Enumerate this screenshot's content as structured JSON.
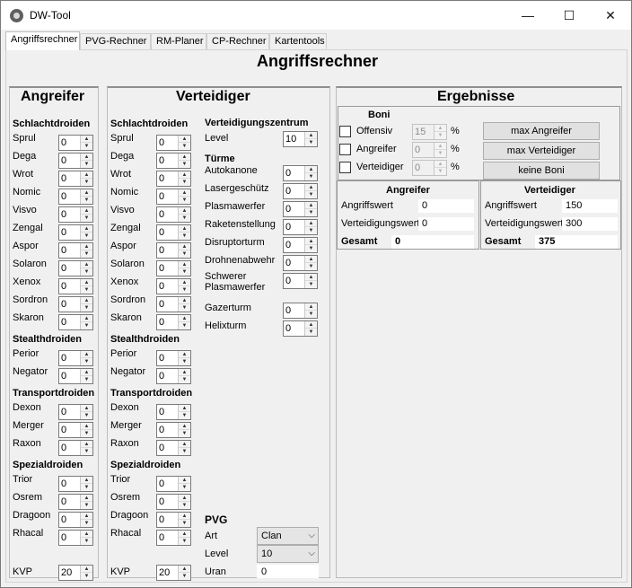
{
  "window": {
    "title": "DW-Tool",
    "minimize": "—",
    "maximize": "☐",
    "close": "✕"
  },
  "tabs": [
    "Angriffsrechner",
    "PVG-Rechner",
    "RM-Planer",
    "CP-Rechner",
    "Kartentools"
  ],
  "page_title": "Angriffsrechner",
  "attacker": {
    "title": "Angreifer",
    "schlacht": {
      "title": "Schlachtdroiden",
      "items": [
        {
          "label": "Sprul",
          "value": "0"
        },
        {
          "label": "Dega",
          "value": "0"
        },
        {
          "label": "Wrot",
          "value": "0"
        },
        {
          "label": "Nomic",
          "value": "0"
        },
        {
          "label": "Visvo",
          "value": "0"
        },
        {
          "label": "Zengal",
          "value": "0"
        },
        {
          "label": "Aspor",
          "value": "0"
        },
        {
          "label": "Solaron",
          "value": "0"
        },
        {
          "label": "Xenox",
          "value": "0"
        },
        {
          "label": "Sordron",
          "value": "0"
        },
        {
          "label": "Skaron",
          "value": "0"
        }
      ]
    },
    "stealth": {
      "title": "Stealthdroiden",
      "items": [
        {
          "label": "Perior",
          "value": "0"
        },
        {
          "label": "Negator",
          "value": "0"
        }
      ]
    },
    "transport": {
      "title": "Transportdroiden",
      "items": [
        {
          "label": "Dexon",
          "value": "0"
        },
        {
          "label": "Merger",
          "value": "0"
        },
        {
          "label": "Raxon",
          "value": "0"
        }
      ]
    },
    "spezial": {
      "title": "Spezialdroiden",
      "items": [
        {
          "label": "Trior",
          "value": "0"
        },
        {
          "label": "Osrem",
          "value": "0"
        },
        {
          "label": "Dragoon",
          "value": "0"
        },
        {
          "label": "Rhacal",
          "value": "0"
        }
      ]
    },
    "kvp": {
      "label": "KVP",
      "value": "20"
    }
  },
  "defender": {
    "title": "Verteidiger",
    "schlacht": {
      "title": "Schlachtdroiden",
      "items": [
        {
          "label": "Sprul",
          "value": "0"
        },
        {
          "label": "Dega",
          "value": "0"
        },
        {
          "label": "Wrot",
          "value": "0"
        },
        {
          "label": "Nomic",
          "value": "0"
        },
        {
          "label": "Visvo",
          "value": "0"
        },
        {
          "label": "Zengal",
          "value": "0"
        },
        {
          "label": "Aspor",
          "value": "0"
        },
        {
          "label": "Solaron",
          "value": "0"
        },
        {
          "label": "Xenox",
          "value": "0"
        },
        {
          "label": "Sordron",
          "value": "0"
        },
        {
          "label": "Skaron",
          "value": "0"
        }
      ]
    },
    "stealth": {
      "title": "Stealthdroiden",
      "items": [
        {
          "label": "Perior",
          "value": "0"
        },
        {
          "label": "Negator",
          "value": "0"
        }
      ]
    },
    "transport": {
      "title": "Transportdroiden",
      "items": [
        {
          "label": "Dexon",
          "value": "0"
        },
        {
          "label": "Merger",
          "value": "0"
        },
        {
          "label": "Raxon",
          "value": "0"
        }
      ]
    },
    "spezial": {
      "title": "Spezialdroiden",
      "items": [
        {
          "label": "Trior",
          "value": "0"
        },
        {
          "label": "Osrem",
          "value": "0"
        },
        {
          "label": "Dragoon",
          "value": "0"
        },
        {
          "label": "Rhacal",
          "value": "0"
        }
      ]
    },
    "kvp": {
      "label": "KVP",
      "value": "20"
    },
    "zentrum": {
      "title": "Verteidigungszentrum",
      "level_label": "Level",
      "level_value": "10"
    },
    "tuerme": {
      "title": "Türme",
      "items": [
        {
          "label": "Autokanone",
          "value": "0"
        },
        {
          "label": "Lasergeschütz",
          "value": "0"
        },
        {
          "label": "Plasmawerfer",
          "value": "0"
        },
        {
          "label": "Raketenstellung",
          "value": "0"
        },
        {
          "label": "Disruptorturm",
          "value": "0"
        },
        {
          "label": "Drohnenabwehr",
          "value": "0"
        },
        {
          "label": "Schwerer Plasmawerfer",
          "value": "0"
        },
        {
          "label": "Gazerturm",
          "value": "0"
        },
        {
          "label": "Helixturm",
          "value": "0"
        }
      ]
    },
    "pvg": {
      "title": "PVG",
      "art_label": "Art",
      "art_value": "Clan",
      "level_label": "Level",
      "level_value": "10",
      "uran_label": "Uran",
      "uran_value": "0"
    }
  },
  "results": {
    "title": "Ergebnisse",
    "boni": {
      "title": "Boni",
      "unit": "%",
      "items": [
        {
          "label": "Offensiv",
          "value": "15"
        },
        {
          "label": "Angreifer",
          "value": "0"
        },
        {
          "label": "Verteidiger",
          "value": "0"
        }
      ]
    },
    "buttons": {
      "max_angreifer": "max Angreifer",
      "max_verteidiger": "max Verteidiger",
      "keine_boni": "keine Boni"
    },
    "attacker": {
      "title": "Angreifer",
      "angriff_label": "Angriffswert",
      "angriff_value": "0",
      "vert_label": "Verteidigungswert",
      "vert_value": "0",
      "gesamt_label": "Gesamt",
      "gesamt_value": "0"
    },
    "defender": {
      "title": "Verteidiger",
      "angriff_label": "Angriffswert",
      "angriff_value": "150",
      "vert_label": "Verteidigungswert",
      "vert_value": "300",
      "gesamt_label": "Gesamt",
      "gesamt_value": "375"
    }
  }
}
